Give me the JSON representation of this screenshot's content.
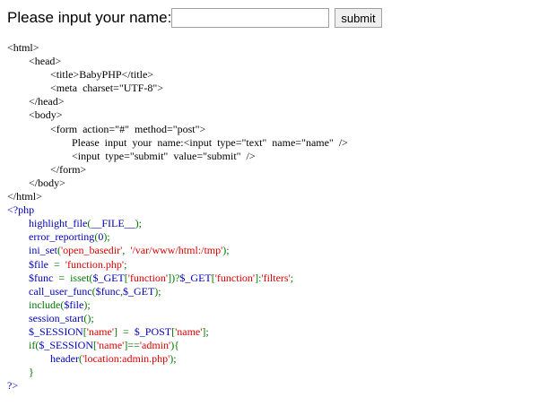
{
  "form": {
    "prompt": "Please input your name:",
    "input_value": "",
    "submit_label": "submit"
  },
  "html_lines": [
    "<html>",
    "\t<head>",
    "\t\t<title>BabyPHP</title>",
    "\t\t<meta  charset=\"UTF-8\">",
    "\t</head>",
    "\t<body>",
    "\t\t<form  action=\"#\"  method=\"post\">",
    "\t\t\tPlease  input  your  name:<input  type=\"text\"  name=\"name\"  />",
    "\t\t\t<input  type=\"submit\"  value=\"submit\"  />",
    "\t\t</form>",
    "\t</body>",
    "</html>"
  ],
  "php_lines": [
    [
      {
        "t": "kw",
        "s": "<?php"
      }
    ],
    [
      {
        "t": "kw",
        "s": "\thighlight_file"
      },
      {
        "t": "cm",
        "s": "("
      },
      {
        "t": "kw",
        "s": "__FILE__"
      },
      {
        "t": "cm",
        "s": ");"
      }
    ],
    [
      {
        "t": "kw",
        "s": "\terror_reporting"
      },
      {
        "t": "cm",
        "s": "("
      },
      {
        "t": "kw",
        "s": "0"
      },
      {
        "t": "cm",
        "s": ");"
      }
    ],
    [
      {
        "t": "kw",
        "s": "\tini_set"
      },
      {
        "t": "cm",
        "s": "("
      },
      {
        "t": "st",
        "s": "'open_basedir'"
      },
      {
        "t": "cm",
        "s": ",  "
      },
      {
        "t": "st",
        "s": "'/var/www/html:/tmp'"
      },
      {
        "t": "cm",
        "s": ");"
      }
    ],
    [
      {
        "t": "kw",
        "s": "\t$file  "
      },
      {
        "t": "cm",
        "s": "=  "
      },
      {
        "t": "st",
        "s": "'function.php'"
      },
      {
        "t": "cm",
        "s": ";"
      }
    ],
    [
      {
        "t": "kw",
        "s": "\t$func  "
      },
      {
        "t": "cm",
        "s": "=  isset("
      },
      {
        "t": "kw",
        "s": "$_GET"
      },
      {
        "t": "cm",
        "s": "["
      },
      {
        "t": "st",
        "s": "'function'"
      },
      {
        "t": "cm",
        "s": "])?"
      },
      {
        "t": "kw",
        "s": "$_GET"
      },
      {
        "t": "cm",
        "s": "["
      },
      {
        "t": "st",
        "s": "'function'"
      },
      {
        "t": "cm",
        "s": "]:"
      },
      {
        "t": "st",
        "s": "'filters'"
      },
      {
        "t": "cm",
        "s": ";"
      }
    ],
    [
      {
        "t": "kw",
        "s": "\tcall_user_func"
      },
      {
        "t": "cm",
        "s": "("
      },
      {
        "t": "kw",
        "s": "$func"
      },
      {
        "t": "cm",
        "s": ","
      },
      {
        "t": "kw",
        "s": "$_GET"
      },
      {
        "t": "cm",
        "s": ");"
      }
    ],
    [
      {
        "t": "cm",
        "s": "\tinclude("
      },
      {
        "t": "kw",
        "s": "$file"
      },
      {
        "t": "cm",
        "s": ");"
      }
    ],
    [
      {
        "t": "kw",
        "s": "\tsession_start"
      },
      {
        "t": "cm",
        "s": "();"
      }
    ],
    [
      {
        "t": "kw",
        "s": "\t$_SESSION"
      },
      {
        "t": "cm",
        "s": "["
      },
      {
        "t": "st",
        "s": "'name'"
      },
      {
        "t": "cm",
        "s": "]  =  "
      },
      {
        "t": "kw",
        "s": "$_POST"
      },
      {
        "t": "cm",
        "s": "["
      },
      {
        "t": "st",
        "s": "'name'"
      },
      {
        "t": "cm",
        "s": "];"
      }
    ],
    [
      {
        "t": "cm",
        "s": "\tif("
      },
      {
        "t": "kw",
        "s": "$_SESSION"
      },
      {
        "t": "cm",
        "s": "["
      },
      {
        "t": "st",
        "s": "'name'"
      },
      {
        "t": "cm",
        "s": "]=="
      },
      {
        "t": "st",
        "s": "'admin'"
      },
      {
        "t": "cm",
        "s": "){"
      }
    ],
    [
      {
        "t": "kw",
        "s": "\t\theader"
      },
      {
        "t": "cm",
        "s": "("
      },
      {
        "t": "st",
        "s": "'location:admin.php'"
      },
      {
        "t": "cm",
        "s": ");"
      }
    ],
    [
      {
        "t": "cm",
        "s": "\t}"
      }
    ],
    [
      {
        "t": "kw",
        "s": "?>"
      }
    ]
  ],
  "colors": {
    "keyword": "#0000bb",
    "string": "#dd0000",
    "operator": "#007700"
  }
}
